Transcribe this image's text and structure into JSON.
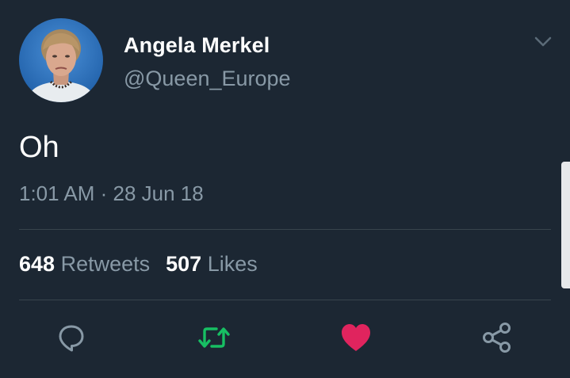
{
  "author": {
    "display_name": "Angela Merkel",
    "handle": "@Queen_Europe",
    "avatar_icon": "profile-photo"
  },
  "tweet": {
    "text": "Oh",
    "timestamp": "1:01 AM · 28 Jun 18"
  },
  "stats": {
    "retweets_count": "648",
    "retweets_label": "Retweets",
    "likes_count": "507",
    "likes_label": "Likes"
  },
  "actions": {
    "reply_icon": "reply-icon",
    "retweet_icon": "retweet-icon",
    "like_icon": "heart-icon",
    "share_icon": "share-icon"
  },
  "colors": {
    "background": "#1c2733",
    "muted_text": "#8899a6",
    "divider": "#38444d",
    "retweet_active": "#17bf63",
    "like_active": "#e0245e"
  }
}
